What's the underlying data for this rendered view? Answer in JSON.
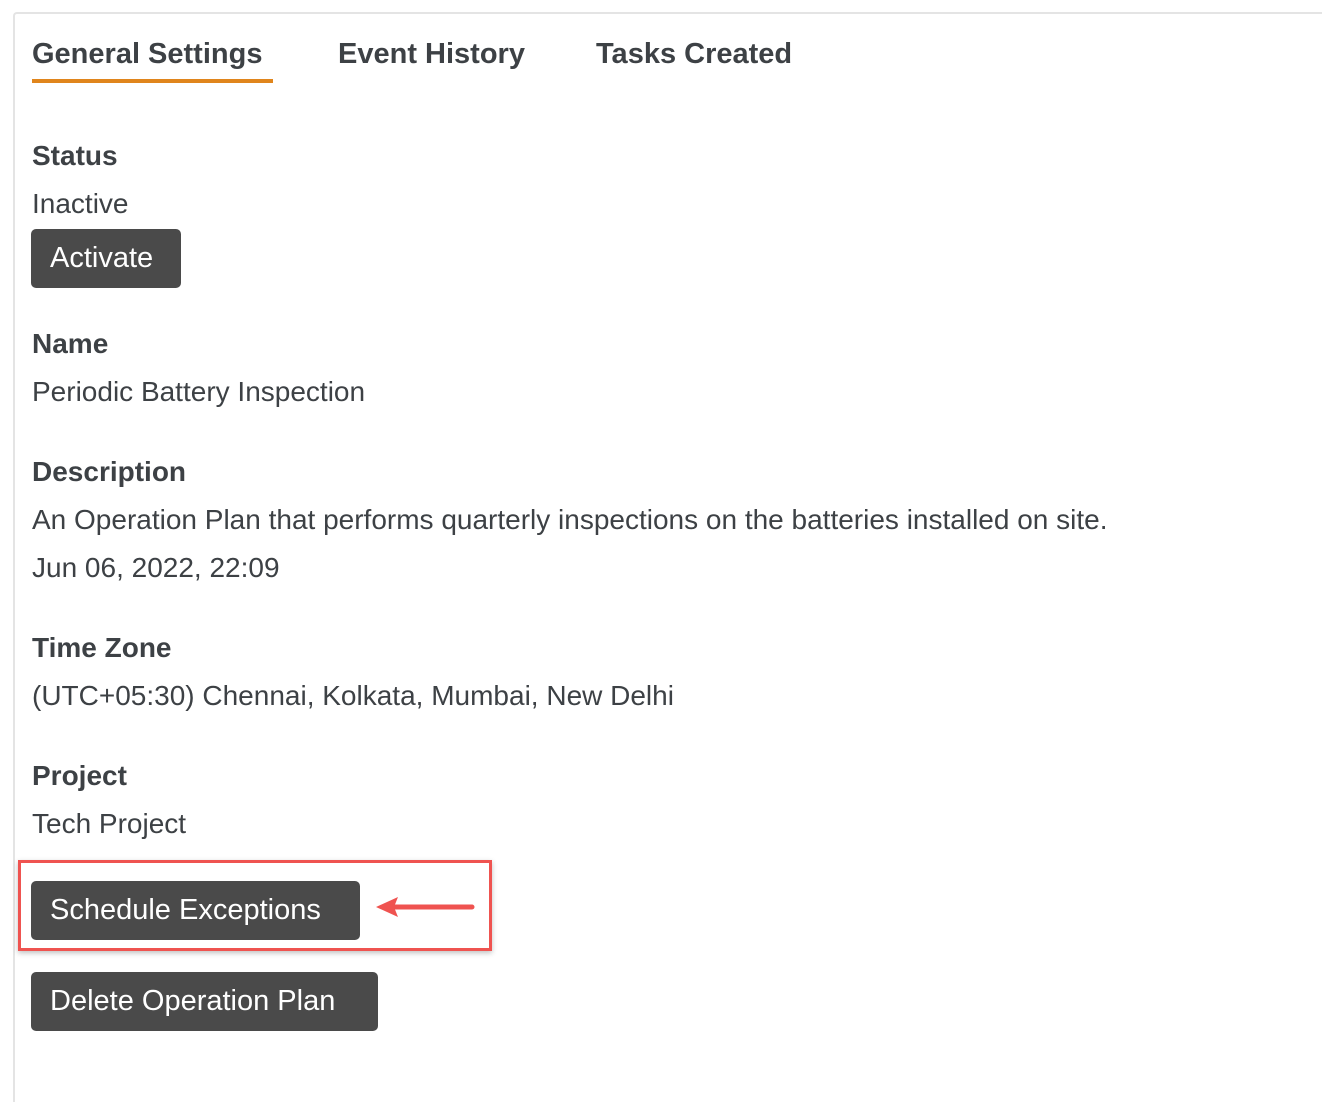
{
  "tabs": [
    {
      "label": "General Settings",
      "active": true
    },
    {
      "label": "Event History",
      "active": false
    },
    {
      "label": "Tasks Created",
      "active": false
    }
  ],
  "status": {
    "label": "Status",
    "value": "Inactive",
    "activate_button": "Activate"
  },
  "name": {
    "label": "Name",
    "value": "Periodic Battery Inspection"
  },
  "description": {
    "label": "Description",
    "value": "An Operation Plan that performs quarterly inspections on the batteries installed on site.",
    "date": "Jun 06, 2022, 22:09"
  },
  "time_zone": {
    "label": "Time Zone",
    "value": "(UTC+05:30) Chennai, Kolkata, Mumbai, New Delhi"
  },
  "project": {
    "label": "Project",
    "value": "Tech Project"
  },
  "actions": {
    "schedule_exceptions": "Schedule Exceptions",
    "delete_plan": "Delete Operation Plan"
  },
  "colors": {
    "tab_underline": "#e0851c",
    "button_bg": "#4a4a4a",
    "highlight": "#ef5350",
    "text": "#3d4145"
  }
}
